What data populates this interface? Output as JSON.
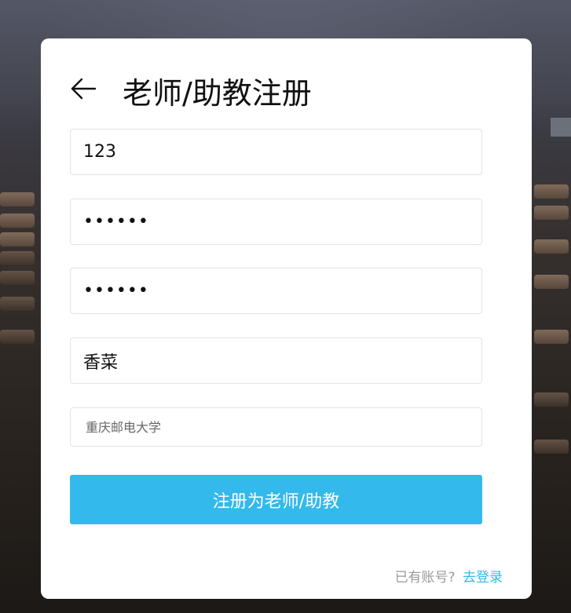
{
  "header": {
    "title": "老师/助教注册",
    "back_icon": "arrow-left-icon"
  },
  "form": {
    "username_value": "123",
    "password_value": "123456",
    "confirm_password_value": "123456",
    "name_value": "香菜",
    "school_placeholder": "重庆邮电大学"
  },
  "submit": {
    "label": "注册为老师/助教",
    "color": "#33b9ec"
  },
  "footer": {
    "hint": "已有账号?",
    "login_link": "去登录"
  }
}
